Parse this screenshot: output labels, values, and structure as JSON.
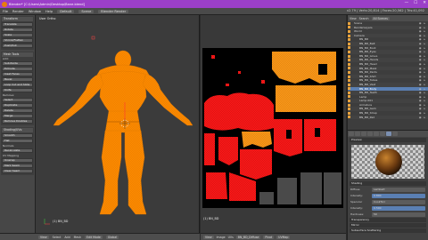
{
  "window": {
    "title": "Blender* [C:\\Users\\Admin\\Desktop\\Bane.blend]",
    "minimize": "—",
    "maximize": "☐",
    "close": "✕"
  },
  "menubar": {
    "items": [
      "File",
      "Render",
      "Window",
      "Help"
    ],
    "layout": "Default",
    "scene": "Scene",
    "engine": "Blender Render",
    "stats": "v2.79 | Verts:20,814 | Faces:20,562 | Tris:41,092"
  },
  "toolshelf": {
    "panels": [
      {
        "title": "Transform",
        "buttons": [
          "Translate",
          "Rotate",
          "Scale",
          "Shrink/Flatten",
          "Push/Pull"
        ]
      },
      {
        "title": "Mesh Tools",
        "buttons": [
          "Subdivide",
          "Extrude",
          "Inset Faces",
          "Bevel",
          "Loop Cut and Slide",
          "Knife",
          "Select",
          "Duplicate",
          "Delete",
          "Merge",
          "Remove Doubles"
        ]
      },
      {
        "title": "Shading",
        "buttons": [
          "Smooth",
          "Flat"
        ]
      },
      {
        "title": "Data",
        "buttons": [
          "Normals",
          "Recalculate",
          "UV Mapping",
          "Unwrap",
          "Mark Seam",
          "Clear Seam"
        ]
      }
    ],
    "labels": [
      "Add:",
      "Remove:",
      "Deform:",
      "Shading/UVs:"
    ]
  },
  "viewport3d": {
    "view_label": "User Ortho",
    "object_label": "(1) BN_BD",
    "header": [
      "View",
      "Select",
      "Add",
      "Mesh",
      "Edit Mode",
      "Global"
    ]
  },
  "uveditor": {
    "label": "(1) BN_BD",
    "header": [
      "View",
      "Image",
      "UVs",
      "BN_BD_Diffuse",
      "Pivot",
      "UVMap"
    ]
  },
  "outliner": {
    "header": [
      "View",
      "Search",
      "All Scenes"
    ],
    "rows": [
      {
        "name": "Scene",
        "selected": false
      },
      {
        "name": "RenderLayers",
        "selected": false
      },
      {
        "name": "World",
        "selected": false
      },
      {
        "name": "Camera",
        "selected": false
      },
      {
        "name": "BN_BD",
        "selected": false
      },
      {
        "name": "BN_BD_Belt",
        "selected": false
      },
      {
        "name": "BN_BD_Boot",
        "selected": false
      },
      {
        "name": "BN_BD_Eyes",
        "selected": false
      },
      {
        "name": "BN_BD_Glove",
        "selected": false
      },
      {
        "name": "BN_BD_Hands",
        "selected": false
      },
      {
        "name": "BN_BD_Head",
        "selected": false
      },
      {
        "name": "BN_BD_Mask",
        "selected": false
      },
      {
        "name": "BN_BD_Pants",
        "selected": false
      },
      {
        "name": "BN_BD_Shirt",
        "selected": false
      },
      {
        "name": "BN_BD_Tubes",
        "selected": false
      },
      {
        "name": "BN_BD_Vest",
        "selected": false
      },
      {
        "name": "BN_BD_Body",
        "selected": true
      },
      {
        "name": "BN_BD_Teeth",
        "selected": false
      },
      {
        "name": "Lamp",
        "selected": false
      },
      {
        "name": "Lamp.001",
        "selected": false
      },
      {
        "name": "Armature",
        "selected": false
      },
      {
        "name": "BN_BD_Gem",
        "selected": false
      },
      {
        "name": "BN_BD_Strap",
        "selected": false
      },
      {
        "name": "BN_BD_Pad",
        "selected": false
      }
    ]
  },
  "properties": {
    "rows": [
      {
        "label": "Diffuse",
        "value": "Lambert"
      },
      {
        "label": "Intensity:",
        "value": "0.800"
      },
      {
        "label": "Specular",
        "value": "CookTorr"
      },
      {
        "label": "Intensity:",
        "value": "0.500"
      },
      {
        "label": "Hardness:",
        "value": "50"
      }
    ],
    "sections": [
      "Preview",
      "Shading",
      "Transparency",
      "Mirror",
      "Subsurface Scattering"
    ]
  },
  "colors": {
    "mesh_orange": "#ff8c00",
    "title_purple": "#9b3fc8",
    "uv_red": "#ff0000",
    "uv_orange": "#ff8c00",
    "selection_blue": "#5a7fb3"
  }
}
